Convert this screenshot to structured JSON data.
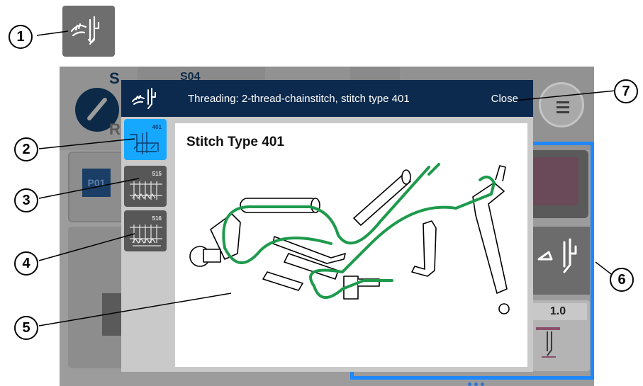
{
  "dialog": {
    "title": "Threading: 2-thread-chainstitch, stitch type 401",
    "close_label": "Close",
    "thumbnails": [
      {
        "number": "401",
        "selected": true
      },
      {
        "number": "515",
        "selected": false
      },
      {
        "number": "516",
        "selected": false
      }
    ],
    "diagram_title": "Stitch Type 401"
  },
  "background": {
    "header_letter": "S",
    "header_code": "S04",
    "header_letter_2": "R",
    "program_badge": "P01",
    "stitch_length_value": "1.0"
  },
  "callouts": [
    "1",
    "2",
    "3",
    "4",
    "5",
    "6",
    "7"
  ],
  "icons": {
    "threading": "threading-hand-needle-icon",
    "menu": "hamburger-menu-icon",
    "logo": "brand-logo-icon"
  },
  "colors": {
    "dialog_header": "#0c2a4d",
    "selected_thumbnail": "#16a8ff",
    "highlight_frame": "#1f88ff",
    "thread_green": "#1e9a4c"
  }
}
